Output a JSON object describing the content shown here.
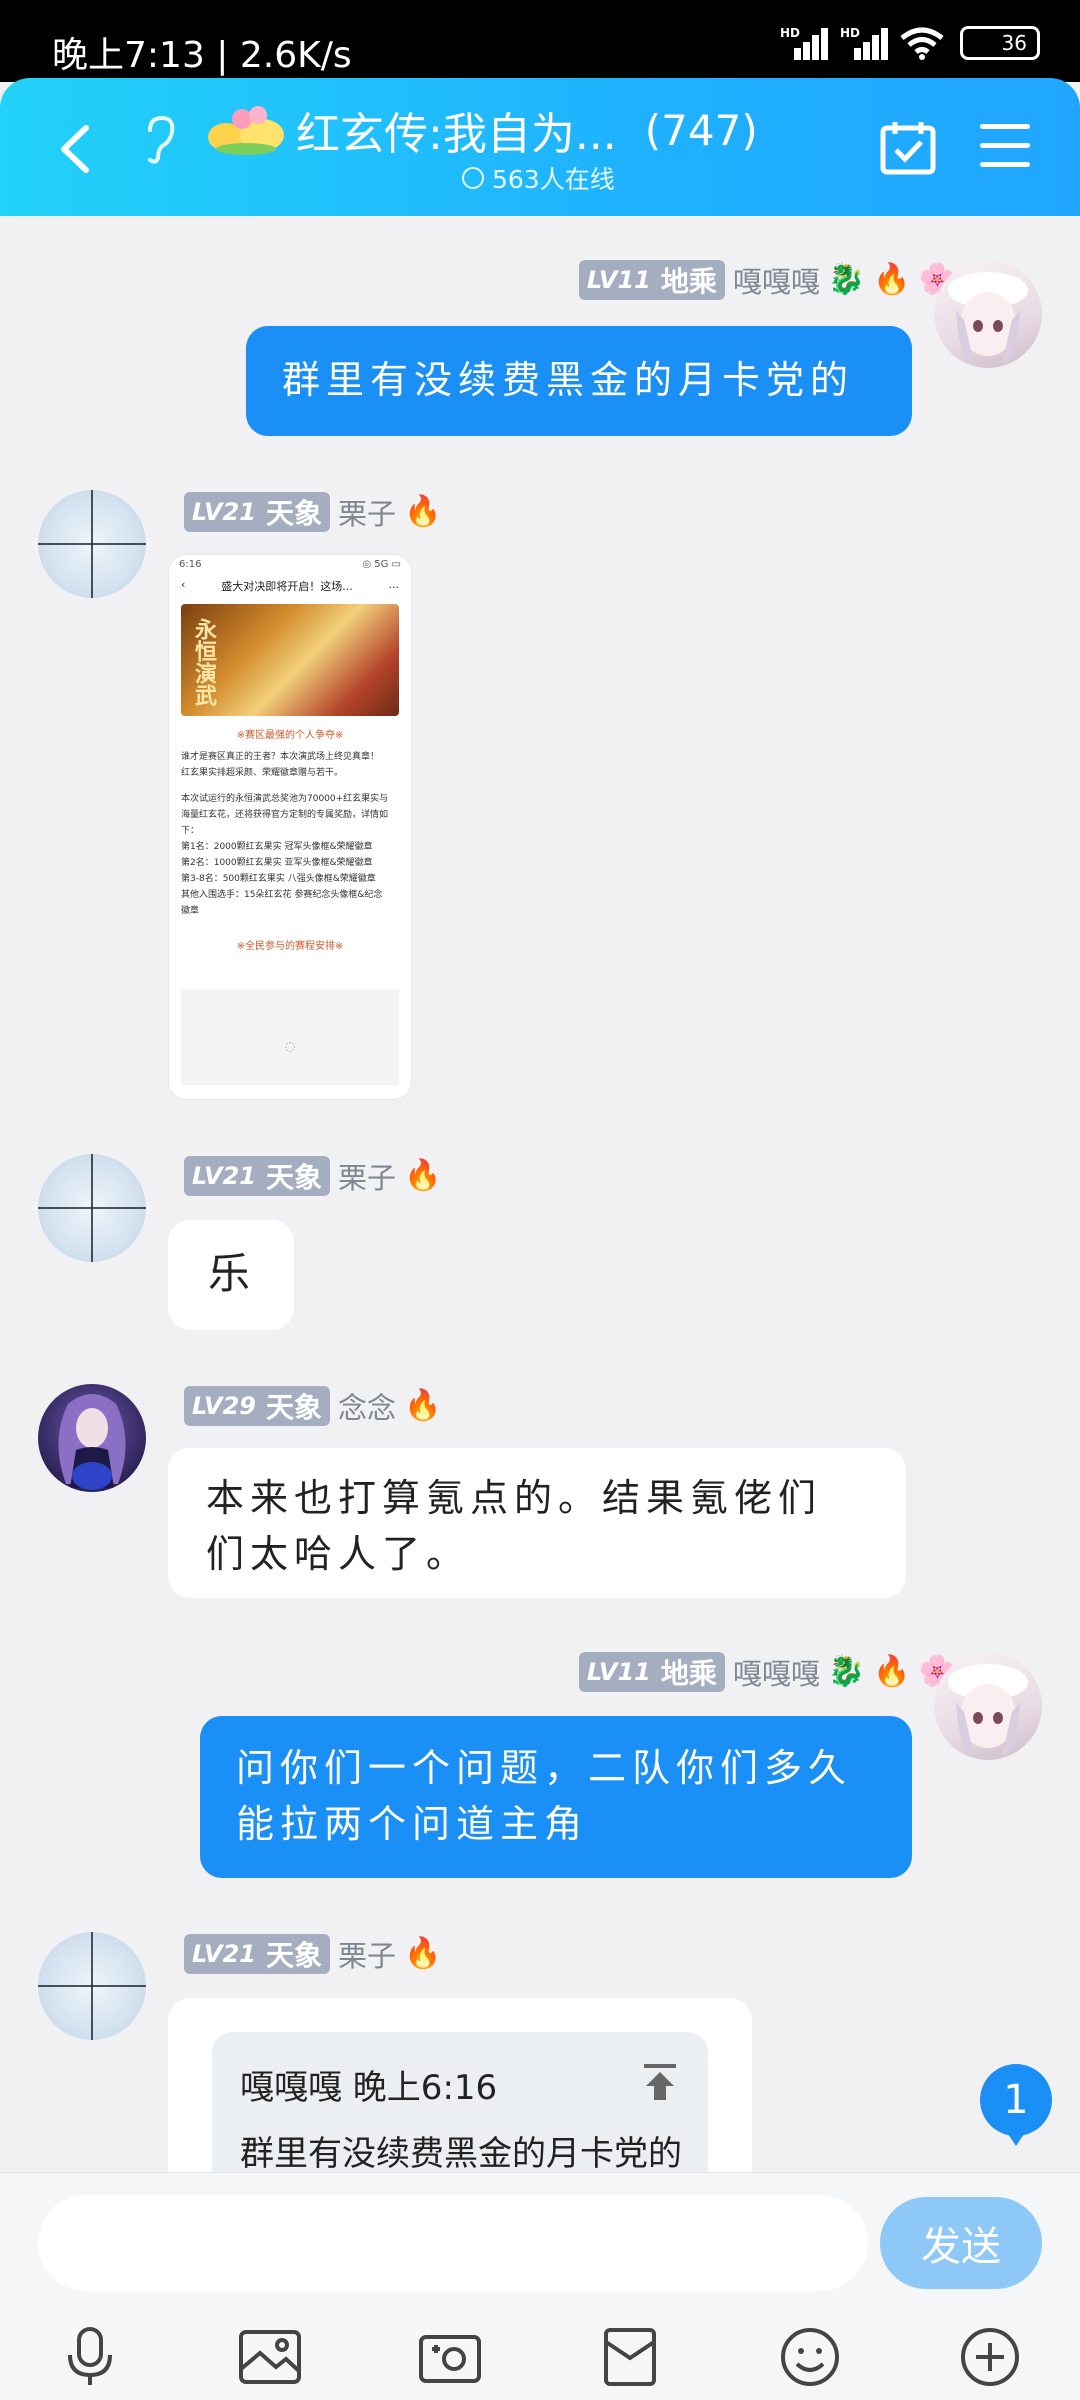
{
  "status_bar": {
    "time": "晚上7:13 | 2.6K/s",
    "net_badge_1": "HD",
    "net_badge_2": "HD",
    "battery": "36"
  },
  "header": {
    "title": "红玄传:我自为...",
    "member_count": "(747)",
    "online": "563人在线"
  },
  "messages": [
    {
      "side": "me",
      "level": "LV11",
      "rank": "地乘",
      "nick": "嘎嘎嘎",
      "text": "群里有没续费黑金的月卡党的"
    },
    {
      "side": "them",
      "level": "LV21",
      "rank": "天象",
      "nick": "栗子",
      "type": "image"
    },
    {
      "side": "them",
      "level": "LV21",
      "rank": "天象",
      "nick": "栗子",
      "text": "乐"
    },
    {
      "side": "them",
      "level": "LV29",
      "rank": "天象",
      "nick": "念念",
      "text_line1": "本来也打算氪点的。结果氪佬们",
      "text_line2": "们太哈人了。"
    },
    {
      "side": "me",
      "level": "LV11",
      "rank": "地乘",
      "nick": "嘎嘎嘎",
      "text_line1": "问你们一个问题，二队你们多久",
      "text_line2": "能拉两个问道主角"
    },
    {
      "side": "them",
      "level": "LV21",
      "rank": "天象",
      "nick": "栗子",
      "type": "quote"
    }
  ],
  "shared_image": {
    "status_time": "6:16",
    "status_right": "◎ 5G ▭",
    "nav_title": "盛大对决即将开启！这场...",
    "nav_more": "...",
    "banner_text": "永恒演武",
    "section_1": "※赛区最强的个人争夺※",
    "intro_1": "谁才是赛区真正的王者？本次演武场上终见真章！",
    "intro_2": "红玄果实排超采颜、荣耀徽章赠与若干。",
    "detail_1": "本次试运行的永恒演武总奖池为70000+红玄果实与",
    "detail_2": "海量红玄花，还将获得官方定制的专属奖励，详情如",
    "detail_3": "下：",
    "prize_1": "第1名：2000颗红玄果实    冠军头像框&荣耀徽章",
    "prize_2": "第2名：1000颗红玄果实    亚军头像框&荣耀徽章",
    "prize_3": "第3-8名：500颗红玄果实    八强头像框&荣耀徽章",
    "prize_4": "其他入围选手：15朵红玄花    参赛纪念头像框&纪念",
    "prize_5": "徽章",
    "section_2": "※全民参与的赛程安排※",
    "loading": "◌"
  },
  "quote": {
    "author_time": "嘎嘎嘎 晚上6:16",
    "text": "群里有没续费黑金的月卡党的"
  },
  "unread_count": "1",
  "input": {
    "placeholder": "",
    "send_label": "发送"
  },
  "colors": {
    "header_start": "#22d2f8",
    "header_end": "#20a6ff",
    "my_bubble": "#1a8ff6",
    "level_badge": "#a5aec0",
    "send_button": "#8ec8f6"
  },
  "icons": {
    "back": "chevron-left-icon",
    "ear": "ear-icon",
    "calendar": "calendar-check-icon",
    "menu": "hamburger-menu-icon",
    "toolbar": [
      "microphone-icon",
      "image-icon",
      "camera-icon",
      "red-packet-icon",
      "emoji-icon",
      "plus-icon"
    ]
  }
}
